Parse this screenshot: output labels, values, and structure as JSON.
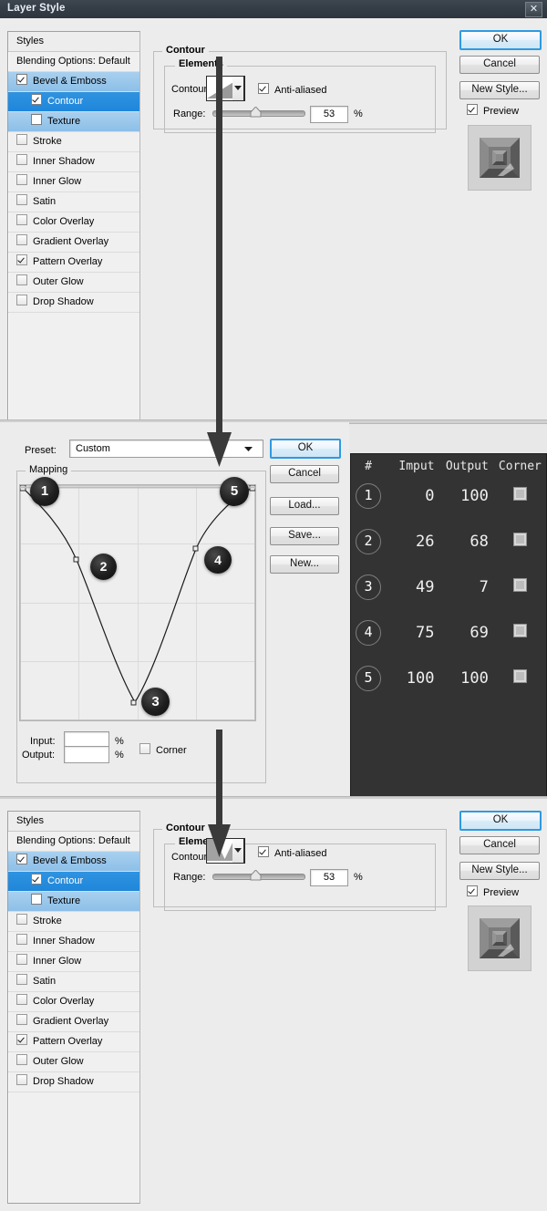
{
  "window": {
    "title": "Layer Style",
    "close_icon": "close-icon"
  },
  "styles_panel": {
    "header": "Styles",
    "blending_options": "Blending Options: Default",
    "items": [
      {
        "label": "Bevel & Emboss",
        "checked": true,
        "selected": true,
        "sub": false
      },
      {
        "label": "Contour",
        "checked": true,
        "selected": true,
        "sub": true
      },
      {
        "label": "Texture",
        "checked": false,
        "selected": true,
        "sub": true
      },
      {
        "label": "Stroke",
        "checked": false,
        "selected": false,
        "sub": false
      },
      {
        "label": "Inner Shadow",
        "checked": false,
        "selected": false,
        "sub": false
      },
      {
        "label": "Inner Glow",
        "checked": false,
        "selected": false,
        "sub": false
      },
      {
        "label": "Satin",
        "checked": false,
        "selected": false,
        "sub": false
      },
      {
        "label": "Color Overlay",
        "checked": false,
        "selected": false,
        "sub": false
      },
      {
        "label": "Gradient Overlay",
        "checked": false,
        "selected": false,
        "sub": false
      },
      {
        "label": "Pattern Overlay",
        "checked": true,
        "selected": false,
        "sub": false
      },
      {
        "label": "Outer Glow",
        "checked": false,
        "selected": false,
        "sub": false
      },
      {
        "label": "Drop Shadow",
        "checked": false,
        "selected": false,
        "sub": false
      }
    ]
  },
  "contour_section": {
    "title": "Contour",
    "elements_title": "Elements",
    "contour_label": "Contour:",
    "anti_aliased_label": "Anti-aliased",
    "anti_aliased_checked": true,
    "range_label": "Range:",
    "range_value": "53",
    "range_unit": "%",
    "swatch_top": "linear-ramp-contour-icon",
    "swatch_bottom": "v-shape-contour-icon",
    "dropdown_icon": "chevron-down-icon"
  },
  "dialog_buttons": {
    "ok": "OK",
    "cancel": "Cancel",
    "new_style": "New Style...",
    "preview_label": "Preview",
    "preview_checked": true
  },
  "contour_editor": {
    "preset_label": "Preset:",
    "preset_value": "Custom",
    "preset_dropdown_icon": "chevron-down-icon",
    "mapping_label": "Mapping",
    "input_label": "Input:",
    "input_value": "",
    "output_label": "Output:",
    "output_value": "",
    "percent": "%",
    "corner_label": "Corner",
    "corner_checked": false,
    "buttons": {
      "ok": "OK",
      "cancel": "Cancel",
      "load": "Load...",
      "save": "Save...",
      "new": "New..."
    }
  },
  "points_table": {
    "columns": [
      "#",
      "Imput",
      "Output",
      "Corner"
    ],
    "rows": [
      {
        "n": "1",
        "input": "0",
        "output": "100",
        "corner": false
      },
      {
        "n": "2",
        "input": "26",
        "output": "68",
        "corner": false
      },
      {
        "n": "3",
        "input": "49",
        "output": "7",
        "corner": false
      },
      {
        "n": "4",
        "input": "75",
        "output": "69",
        "corner": false
      },
      {
        "n": "5",
        "input": "100",
        "output": "100",
        "corner": false
      }
    ]
  },
  "chart_data": {
    "type": "line",
    "title": "Mapping",
    "xlabel": "Input",
    "ylabel": "Output",
    "xlim": [
      0,
      100
    ],
    "ylim": [
      0,
      100
    ],
    "grid": true,
    "legend": "none",
    "x": [
      0,
      26,
      49,
      75,
      100
    ],
    "y": [
      100,
      68,
      7,
      69,
      100
    ],
    "point_labels": [
      "1",
      "2",
      "3",
      "4",
      "5"
    ],
    "series": [
      {
        "name": "contour-curve",
        "x": [
          0,
          26,
          49,
          75,
          100
        ],
        "values": [
          100,
          68,
          7,
          69,
          100
        ]
      }
    ]
  },
  "colors": {
    "title_bar": "#343c46",
    "accent_selected": "#1f86da",
    "accent_selected_light": "#8dbfe8",
    "primary_button_border": "#2e9ae0",
    "dark_panel": "#333333",
    "panel_bg": "#ececec"
  }
}
